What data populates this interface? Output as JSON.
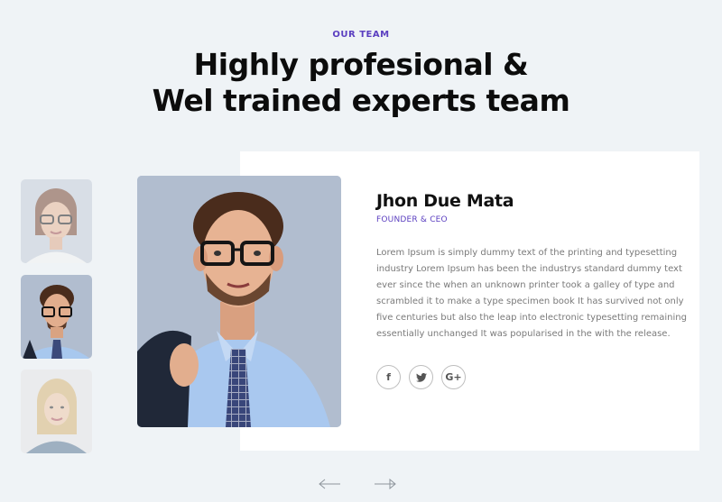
{
  "header": {
    "eyebrow": "OUR TEAM",
    "title_line1": "Highly profesional &",
    "title_line2": "Wel trained experts team"
  },
  "member": {
    "name": "Jhon Due Mata",
    "role": "FOUNDER & CEO",
    "bio_lines": [
      "Lorem Ipsum is simply dummy text of the printing and typesetting",
      "industry Lorem Ipsum has been the industrys standard dummy text",
      "ever since the when an unknown printer took a galley of type and",
      "scrambled it to make a type specimen book It has survived not only",
      "five centuries but also the leap into electronic typesetting remaining",
      "essentially unchanged It was popularised in the with the release."
    ]
  },
  "socials": [
    {
      "icon": "facebook-icon",
      "glyph": "f"
    },
    {
      "icon": "twitter-icon",
      "glyph": "t"
    },
    {
      "icon": "google-plus-icon",
      "glyph": "G+"
    }
  ],
  "thumbnails": [
    {
      "person": "woman-with-glasses",
      "active": false
    },
    {
      "person": "man-with-glasses",
      "active": true
    },
    {
      "person": "blonde-woman",
      "active": false
    }
  ],
  "nav": {
    "prev": "previous-arrow",
    "next": "next-arrow"
  },
  "colors": {
    "background": "#eff3f6",
    "accent": "#5b3fc0",
    "card": "#ffffff"
  }
}
